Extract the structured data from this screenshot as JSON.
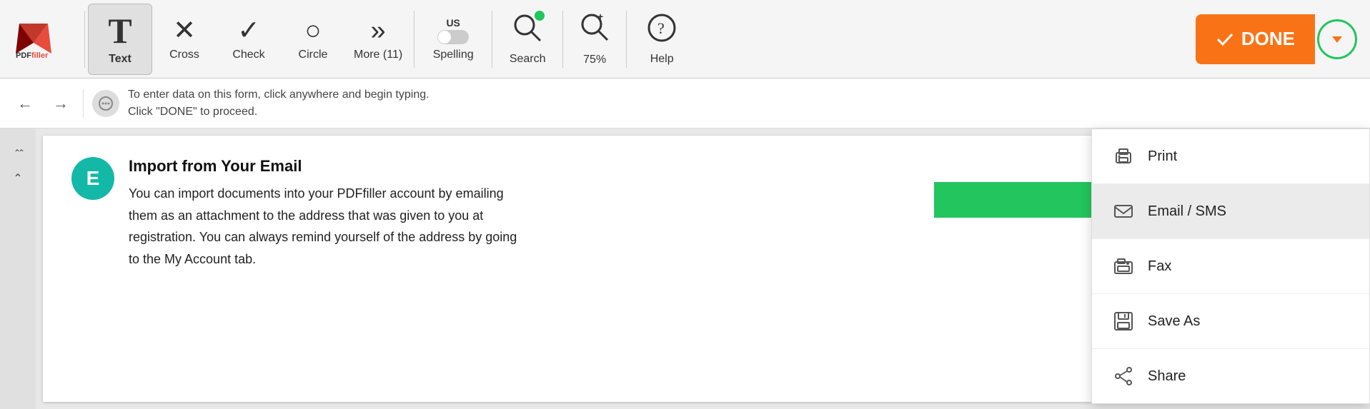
{
  "logo": {
    "text": "PDFfiller"
  },
  "toolbar": {
    "tools": [
      {
        "id": "text",
        "label": "Text",
        "icon": "T",
        "active": true
      },
      {
        "id": "cross",
        "label": "Cross",
        "icon": "✕",
        "active": false
      },
      {
        "id": "check",
        "label": "Check",
        "icon": "✓",
        "active": false
      },
      {
        "id": "circle",
        "label": "Circle",
        "icon": "○",
        "active": false
      },
      {
        "id": "more",
        "label": "More (11)",
        "icon": "»",
        "active": false
      }
    ],
    "spelling": {
      "us_label": "US",
      "label": "Spelling"
    },
    "search": {
      "label": "Search"
    },
    "zoom": {
      "label": "75%"
    },
    "help": {
      "label": "Help"
    },
    "done_label": "DONE"
  },
  "info_bar": {
    "message_line1": "To enter data on this form, click anywhere and begin typing.",
    "message_line2": "Click \"DONE\" to proceed."
  },
  "content": {
    "avatar_letter": "E",
    "title": "Import from Your Email",
    "body": "You can import documents into your PDFfiller account by emailing\nthem as an attachment to the address that was given to you at\nregistration. You can always remind yourself of the address by going\nto the My Account tab."
  },
  "dropdown": {
    "items": [
      {
        "id": "print",
        "label": "Print"
      },
      {
        "id": "email-sms",
        "label": "Email / SMS",
        "selected": true
      },
      {
        "id": "fax",
        "label": "Fax"
      },
      {
        "id": "save-as",
        "label": "Save As"
      },
      {
        "id": "share",
        "label": "Share"
      }
    ]
  },
  "left_controls": [
    {
      "id": "double-up",
      "icon": "⋀⋀"
    },
    {
      "id": "up",
      "icon": "⋀"
    }
  ]
}
